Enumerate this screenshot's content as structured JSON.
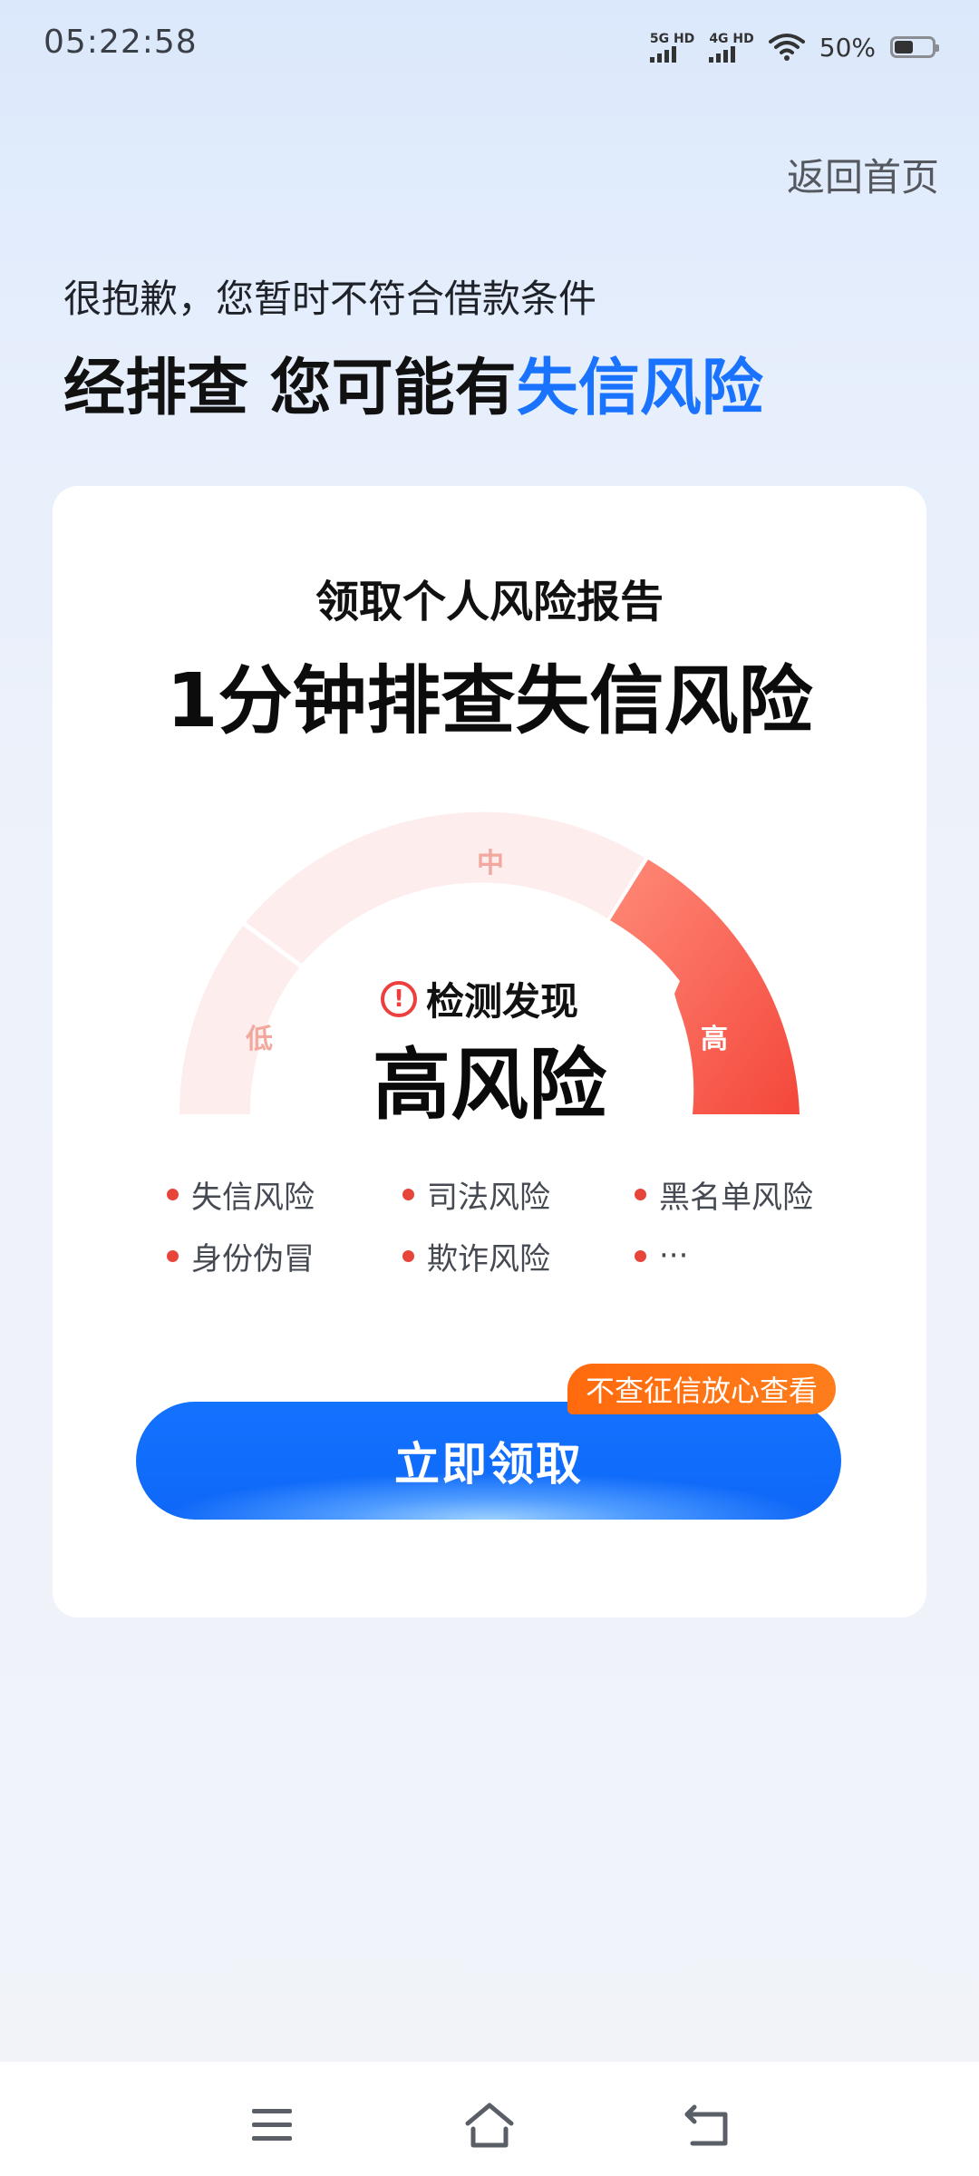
{
  "status_bar": {
    "time": "05:22:58",
    "sim1_label": "5G HD",
    "sim2_label": "4G HD",
    "battery_percent": "50%",
    "battery_level": 0.5,
    "icons": [
      "signal-5g-icon",
      "signal-4g-icon",
      "wifi-icon",
      "battery-icon"
    ]
  },
  "header": {
    "back_home": "返回首页",
    "sorry_text": "很抱歉，您暂时不符合借款条件",
    "headline_black": "经排查 您可能有",
    "headline_blue": "失信风险",
    "accent_color": "#1a73ff"
  },
  "card": {
    "subtitle": "领取个人风险报告",
    "title": "1分钟排查失信风险",
    "gauge": {
      "label_low": "低",
      "label_mid": "中",
      "label_high": "高",
      "active_level": "高",
      "detect_label": "检测发现",
      "detect_icon": "warning-circle-icon",
      "result": "高风险"
    },
    "risks": [
      {
        "label": "失信风险"
      },
      {
        "label": "司法风险"
      },
      {
        "label": "黑名单风险"
      },
      {
        "label": "身份伪冒"
      },
      {
        "label": "欺诈风险"
      },
      {
        "label": "···"
      }
    ],
    "cta_label": "立即领取",
    "cta_badge": "不查征信放心查看",
    "cta_color": "#1273ff",
    "badge_color": "#ff6a0d",
    "risk_dot_color": "#e8443a"
  },
  "nav_bar": {
    "icons": [
      "menu-icon",
      "home-icon",
      "back-icon"
    ]
  }
}
